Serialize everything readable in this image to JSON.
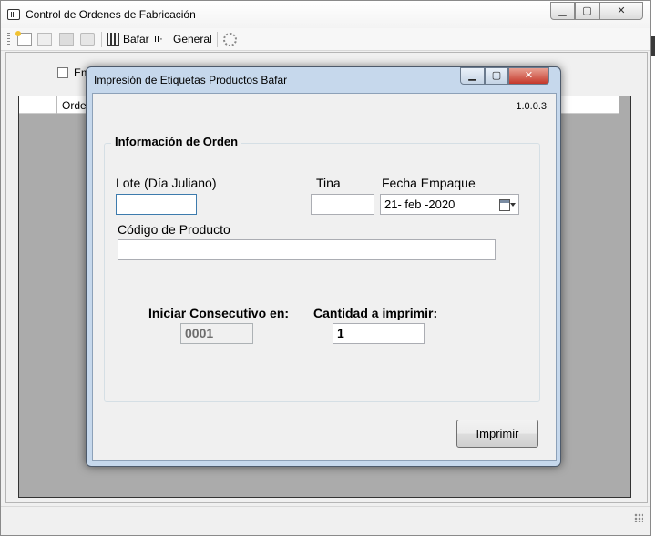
{
  "main_window": {
    "title": "Control de Ordenes de Fabricación",
    "controls": {
      "minimize": "▁",
      "maximize": "▢",
      "close": "✕"
    }
  },
  "toolbar": {
    "bafar_label": "Bafar",
    "general_label": "General",
    "general_icon_glyph": "ıı·"
  },
  "content": {
    "checkbox_label": "Em",
    "grid_column_header": "Orden"
  },
  "dialog": {
    "title": "Impresión de Etiquetas Productos Bafar",
    "controls": {
      "minimize": "▁",
      "maximize": "▢",
      "close": "✕"
    },
    "version": "1.0.0.3",
    "group_title": "Información de Orden",
    "fields": {
      "lote_label": "Lote (Día Juliano)",
      "lote_value": "",
      "tina_label": "Tina",
      "tina_value": "",
      "fecha_label": "Fecha Empaque",
      "fecha_value": "21- feb -2020",
      "codigo_label": "Código de Producto",
      "codigo_value": "",
      "consecutivo_label": "Iniciar Consecutivo en:",
      "consecutivo_value": "0001",
      "cantidad_label": "Cantidad a imprimir:",
      "cantidad_value": "1"
    },
    "print_button": "Imprimir"
  },
  "icons": [
    "app-icon",
    "new-doc-icon",
    "edit-icon",
    "print-icon",
    "preview-icon",
    "chart-icon",
    "general-icon",
    "gear-icon",
    "calendar-icon",
    "resize-grip-icon"
  ],
  "colors": {
    "dialog_frame": "#c6d8ec",
    "close_button": "#c4372a",
    "grid_background": "#ababab",
    "window_background": "#f0f0f0"
  }
}
